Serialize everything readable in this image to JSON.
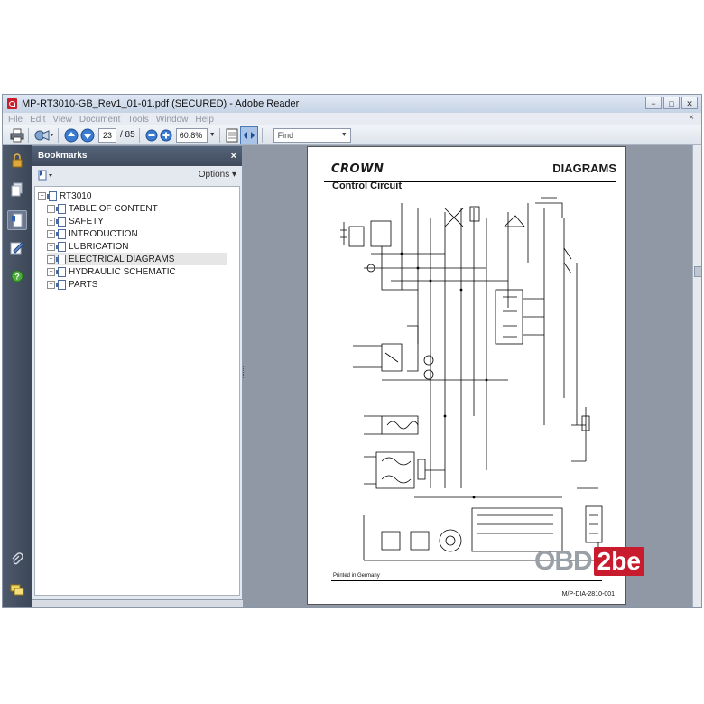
{
  "window": {
    "title": "MP-RT3010-GB_Rev1_01-01.pdf (SECURED) - Adobe Reader",
    "controls": [
      "−",
      "□",
      "✕"
    ]
  },
  "menu": {
    "items": [
      "File",
      "Edit",
      "View",
      "Document",
      "Tools",
      "Window",
      "Help"
    ],
    "close": "×"
  },
  "toolbar": {
    "page_current": "23",
    "page_total": "/ 85",
    "zoom": "60.8%",
    "find_placeholder": "Find"
  },
  "nav_icons": [
    "lock-icon",
    "pages-icon",
    "bookmarks-icon",
    "signature-icon",
    "help-icon",
    "attachments-icon",
    "comments-icon"
  ],
  "bookmarks": {
    "title": "Bookmarks",
    "close": "×",
    "options": "Options ▾",
    "root": "RT3010",
    "items": [
      {
        "label": "TABLE OF CONTENT",
        "selected": false
      },
      {
        "label": "SAFETY",
        "selected": false
      },
      {
        "label": "INTRODUCTION",
        "selected": false
      },
      {
        "label": "LUBRICATION",
        "selected": false
      },
      {
        "label": "ELECTRICAL DIAGRAMS",
        "selected": true
      },
      {
        "label": "HYDRAULIC SCHEMATIC",
        "selected": false
      },
      {
        "label": "PARTS",
        "selected": false
      }
    ]
  },
  "document": {
    "logo": "CROWN",
    "heading": "DIAGRAMS",
    "section": "Control Circuit",
    "printed": "Printed in Germany",
    "code": "M/P-DIA-2810-001"
  },
  "watermark": {
    "left": "OBD",
    "right": "2be",
    "accent": "#c81c2e"
  }
}
